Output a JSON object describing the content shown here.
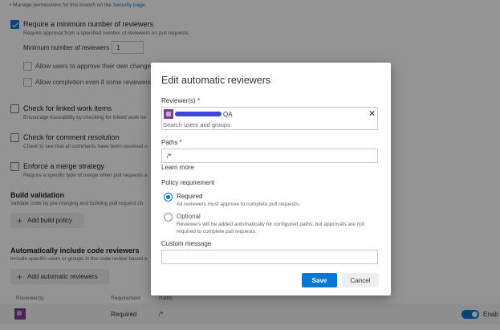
{
  "header_text": {
    "prefix": "• Manage permissions for this branch on the ",
    "link": "Security page"
  },
  "min_reviewers": {
    "title": "Require a minimum number of reviewers",
    "desc": "Require approval from a specified number of reviewers on pull requests.",
    "count_label": "Minimum number of reviewers",
    "count_value": "1",
    "opt_own": "Allow users to approve their own changes",
    "opt_completion": "Allow completion even if some reviewers"
  },
  "linked_work": {
    "title": "Check for linked work items",
    "desc": "Encourage traceability by checking for linked work ite"
  },
  "comment_res": {
    "title": "Check for comment resolution",
    "desc": "Check to see that all comments have been resolved o"
  },
  "merge_strategy": {
    "title": "Enforce a merge strategy",
    "desc": "Require a specific type of merge when pull requests a"
  },
  "build_validation": {
    "title": "Build validation",
    "desc": "Validate code by pre-merging and building pull request ch",
    "button": "Add build policy"
  },
  "auto_reviewers": {
    "title": "Automatically include code reviewers",
    "desc": "Include specific users or groups in the code review based o",
    "button": "Add automatic reviewers",
    "col_reviewers": "Reviewer(s)",
    "col_requirement": "Requirement",
    "col_paths": "Paths",
    "row_requirement": "Required",
    "row_path": "/*",
    "toggle_label": "Enab"
  },
  "dialog": {
    "title": "Edit automatic reviewers",
    "reviewers_label": "Reviewer(s) *",
    "reviewer_chip_suffix": "QA",
    "search_placeholder": "Search users and groups",
    "paths_label": "Paths *",
    "paths_value": "/*",
    "learn_more": "Learn more",
    "policy_label": "Policy requirement",
    "required_label": "Required",
    "required_desc": "All reviewers must approve to complete pull requests.",
    "optional_label": "Optional",
    "optional_desc_1": "Reviewers will be added automatically for configured paths, but approvals are not",
    "optional_desc_2": "required to complete pull requests.",
    "custom_message_label": "Custom message",
    "save": "Save",
    "cancel": "Cancel"
  },
  "colors": {
    "accent": "#0078d4",
    "overlay": "rgba(0,0,0,0.42)"
  }
}
